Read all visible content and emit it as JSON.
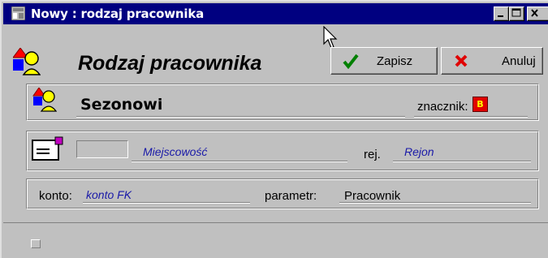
{
  "window": {
    "title": "Nowy : rodzaj pracownika",
    "heading": "Rodzaj pracownika",
    "titlebar_color": "#000080"
  },
  "toolbar": {
    "save_label": "Zapisz",
    "cancel_label": "Anuluj",
    "save_icon": "checkmark-icon",
    "cancel_icon": "x-icon"
  },
  "record": {
    "name": "Sezonowi",
    "marker_label": "znacznik:",
    "marker_value": "B",
    "marker_color": "#e00000"
  },
  "location": {
    "city_placeholder": "Miejscowość",
    "region_label": "rej.",
    "region_placeholder": "Rejon"
  },
  "account": {
    "konto_label": "konto:",
    "konto_value": "konto FK",
    "param_label": "parametr:",
    "param_value": "Pracownik"
  }
}
